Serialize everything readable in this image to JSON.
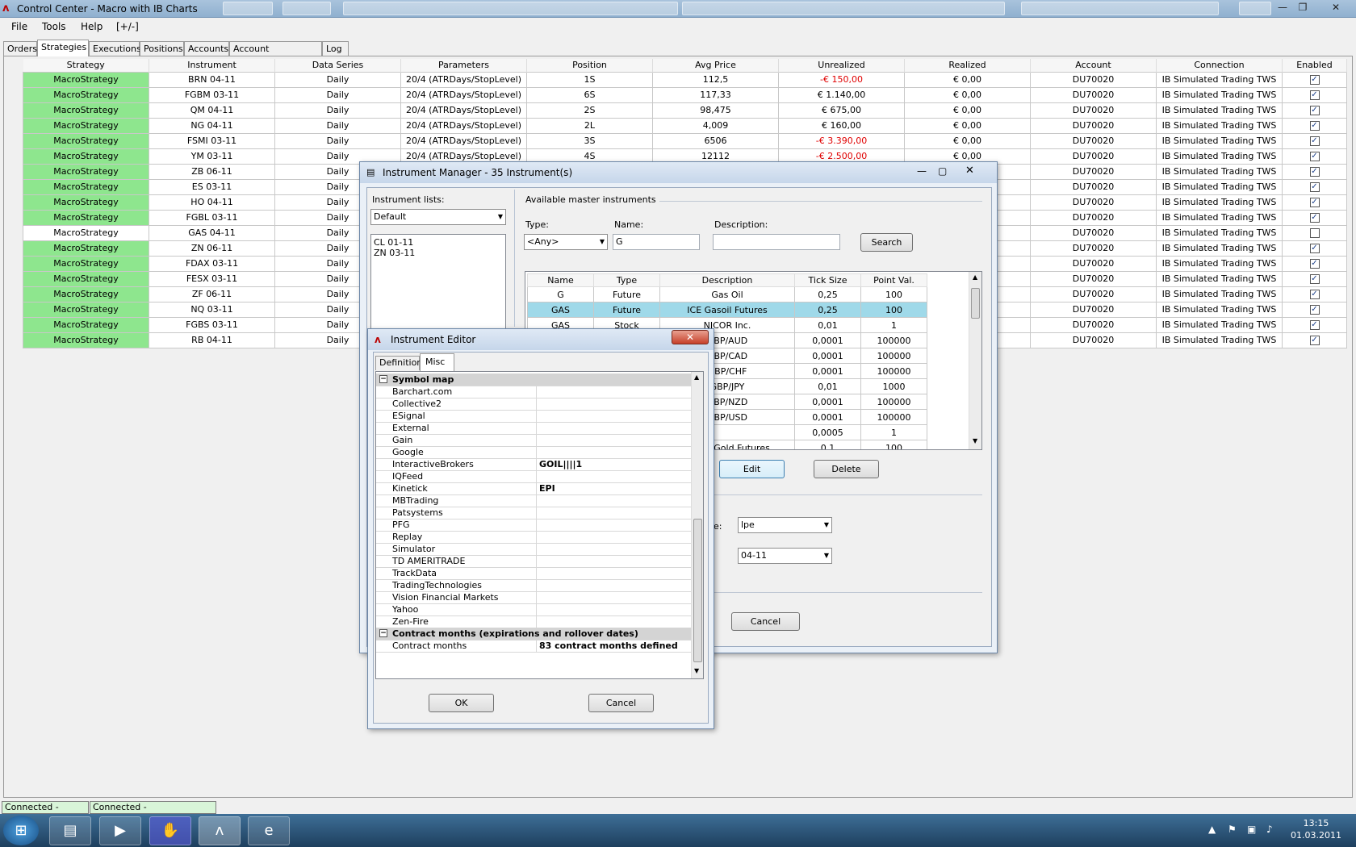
{
  "window": {
    "title": "Control Center - Macro with IB Charts"
  },
  "menu": [
    "File",
    "Tools",
    "Help",
    "[+/-]"
  ],
  "tabs": [
    "Orders",
    "Strategies",
    "Executions",
    "Positions",
    "Accounts",
    "Account Performance",
    "Log"
  ],
  "active_tab": "Strategies",
  "strategies": {
    "columns": [
      "Strategy",
      "Instrument",
      "Data Series",
      "Parameters",
      "Position",
      "Avg Price",
      "Unrealized",
      "Realized",
      "Account",
      "Connection",
      "Enabled"
    ],
    "rows": [
      {
        "strategy": "MacroStrategy",
        "instrument": "BRN 04-11",
        "series": "Daily",
        "params": "20/4 (ATRDays/StopLevel)",
        "position": "1S",
        "avg": "112,5",
        "unrealized": "-€ 150,00",
        "realized": "€ 0,00",
        "account": "DU70020",
        "connection": "IB Simulated Trading TWS",
        "enabled": true,
        "neg": true
      },
      {
        "strategy": "MacroStrategy",
        "instrument": "FGBM 03-11",
        "series": "Daily",
        "params": "20/4 (ATRDays/StopLevel)",
        "position": "6S",
        "avg": "117,33",
        "unrealized": "€ 1.140,00",
        "realized": "€ 0,00",
        "account": "DU70020",
        "connection": "IB Simulated Trading TWS",
        "enabled": true,
        "neg": false
      },
      {
        "strategy": "MacroStrategy",
        "instrument": "QM 04-11",
        "series": "Daily",
        "params": "20/4 (ATRDays/StopLevel)",
        "position": "2S",
        "avg": "98,475",
        "unrealized": "€ 675,00",
        "realized": "€ 0,00",
        "account": "DU70020",
        "connection": "IB Simulated Trading TWS",
        "enabled": true,
        "neg": false
      },
      {
        "strategy": "MacroStrategy",
        "instrument": "NG 04-11",
        "series": "Daily",
        "params": "20/4 (ATRDays/StopLevel)",
        "position": "2L",
        "avg": "4,009",
        "unrealized": "€ 160,00",
        "realized": "€ 0,00",
        "account": "DU70020",
        "connection": "IB Simulated Trading TWS",
        "enabled": true,
        "neg": false
      },
      {
        "strategy": "MacroStrategy",
        "instrument": "FSMI 03-11",
        "series": "Daily",
        "params": "20/4 (ATRDays/StopLevel)",
        "position": "3S",
        "avg": "6506",
        "unrealized": "-€ 3.390,00",
        "realized": "€ 0,00",
        "account": "DU70020",
        "connection": "IB Simulated Trading TWS",
        "enabled": true,
        "neg": true
      },
      {
        "strategy": "MacroStrategy",
        "instrument": "YM 03-11",
        "series": "Daily",
        "params": "20/4 (ATRDays/StopLevel)",
        "position": "4S",
        "avg": "12112",
        "unrealized": "-€ 2.500,00",
        "realized": "€ 0,00",
        "account": "DU70020",
        "connection": "IB Simulated Trading TWS",
        "enabled": true,
        "neg": true
      },
      {
        "strategy": "MacroStrategy",
        "instrument": "ZB 06-11",
        "series": "Daily",
        "params": "",
        "position": "",
        "avg": "",
        "unrealized": "",
        "realized": "€ 0,00",
        "account": "DU70020",
        "connection": "IB Simulated Trading TWS",
        "enabled": true,
        "neg": false
      },
      {
        "strategy": "MacroStrategy",
        "instrument": "ES 03-11",
        "series": "Daily",
        "params": "",
        "position": "",
        "avg": "",
        "unrealized": "",
        "realized": "€ 0,00",
        "account": "DU70020",
        "connection": "IB Simulated Trading TWS",
        "enabled": true,
        "neg": false
      },
      {
        "strategy": "MacroStrategy",
        "instrument": "HO 04-11",
        "series": "Daily",
        "params": "",
        "position": "",
        "avg": "",
        "unrealized": "",
        "realized": "€ 0,00",
        "account": "DU70020",
        "connection": "IB Simulated Trading TWS",
        "enabled": true,
        "neg": false
      },
      {
        "strategy": "MacroStrategy",
        "instrument": "FGBL 03-11",
        "series": "Daily",
        "params": "",
        "position": "",
        "avg": "",
        "unrealized": "",
        "realized": "€ 0,00",
        "account": "DU70020",
        "connection": "IB Simulated Trading TWS",
        "enabled": true,
        "neg": false
      },
      {
        "strategy": "MacroStrategy",
        "instrument": "GAS 04-11",
        "series": "Daily",
        "params": "",
        "position": "",
        "avg": "",
        "unrealized": "",
        "realized": "€ 0,00",
        "account": "DU70020",
        "connection": "IB Simulated Trading TWS",
        "enabled": false,
        "neg": false
      },
      {
        "strategy": "MacroStrategy",
        "instrument": "ZN 06-11",
        "series": "Daily",
        "params": "",
        "position": "",
        "avg": "",
        "unrealized": "",
        "realized": "€ 0,00",
        "account": "DU70020",
        "connection": "IB Simulated Trading TWS",
        "enabled": true,
        "neg": false
      },
      {
        "strategy": "MacroStrategy",
        "instrument": "FDAX 03-11",
        "series": "Daily",
        "params": "",
        "position": "",
        "avg": "",
        "unrealized": "",
        "realized": "€ 0,00",
        "account": "DU70020",
        "connection": "IB Simulated Trading TWS",
        "enabled": true,
        "neg": false
      },
      {
        "strategy": "MacroStrategy",
        "instrument": "FESX 03-11",
        "series": "Daily",
        "params": "",
        "position": "",
        "avg": "",
        "unrealized": "",
        "realized": "€ 0,00",
        "account": "DU70020",
        "connection": "IB Simulated Trading TWS",
        "enabled": true,
        "neg": false
      },
      {
        "strategy": "MacroStrategy",
        "instrument": "ZF 06-11",
        "series": "Daily",
        "params": "",
        "position": "",
        "avg": "",
        "unrealized": "",
        "realized": "€ 0,00",
        "account": "DU70020",
        "connection": "IB Simulated Trading TWS",
        "enabled": true,
        "neg": false
      },
      {
        "strategy": "MacroStrategy",
        "instrument": "NQ 03-11",
        "series": "Daily",
        "params": "",
        "position": "",
        "avg": "",
        "unrealized": "",
        "realized": "€ 0,00",
        "account": "DU70020",
        "connection": "IB Simulated Trading TWS",
        "enabled": true,
        "neg": false
      },
      {
        "strategy": "MacroStrategy",
        "instrument": "FGBS 03-11",
        "series": "Daily",
        "params": "",
        "position": "",
        "avg": "",
        "unrealized": "",
        "realized": "€ 0,00",
        "account": "DU70020",
        "connection": "IB Simulated Trading TWS",
        "enabled": true,
        "neg": false
      },
      {
        "strategy": "MacroStrategy",
        "instrument": "RB 04-11",
        "series": "Daily",
        "params": "",
        "position": "",
        "avg": "",
        "unrealized": "",
        "realized": "€ 0,00",
        "account": "DU70020",
        "connection": "IB Simulated Trading TWS",
        "enabled": true,
        "neg": false
      }
    ]
  },
  "instrument_manager": {
    "title": "Instrument Manager - 35 Instrument(s)",
    "lists_label": "Instrument lists:",
    "list_selected": "Default",
    "list_items": [
      "CL 01-11",
      "ZN 03-11"
    ],
    "available_label": "Available master instruments",
    "type_label": "Type:",
    "type_value": "<Any>",
    "name_label": "Name:",
    "name_value": "G",
    "desc_label": "Description:",
    "desc_value": "",
    "search_label": "Search",
    "columns": [
      "Name",
      "Type",
      "Description",
      "Tick Size",
      "Point Val."
    ],
    "rows": [
      {
        "name": "G",
        "type": "Future",
        "desc": "Gas Oil",
        "tick": "0,25",
        "point": "100",
        "sel": false
      },
      {
        "name": "GAS",
        "type": "Future",
        "desc": "ICE Gasoil Futures",
        "tick": "0,25",
        "point": "100",
        "sel": true
      },
      {
        "name": "GAS",
        "type": "Stock",
        "desc": "NICOR Inc.",
        "tick": "0,01",
        "point": "1",
        "sel": false
      },
      {
        "name": "",
        "type": "",
        "desc": "GBP/AUD",
        "tick": "0,0001",
        "point": "100000",
        "sel": false
      },
      {
        "name": "",
        "type": "",
        "desc": "GBP/CAD",
        "tick": "0,0001",
        "point": "100000",
        "sel": false
      },
      {
        "name": "",
        "type": "",
        "desc": "GBP/CHF",
        "tick": "0,0001",
        "point": "100000",
        "sel": false
      },
      {
        "name": "",
        "type": "",
        "desc": "GBP/JPY",
        "tick": "0,01",
        "point": "1000",
        "sel": false
      },
      {
        "name": "",
        "type": "",
        "desc": "GBP/NZD",
        "tick": "0,0001",
        "point": "100000",
        "sel": false
      },
      {
        "name": "",
        "type": "",
        "desc": "GBP/USD",
        "tick": "0,0001",
        "point": "100000",
        "sel": false
      },
      {
        "name": "",
        "type": "",
        "desc": "",
        "tick": "0,0005",
        "point": "1",
        "sel": false
      },
      {
        "name": "",
        "type": "",
        "desc": "OMEX Gold Futures",
        "tick": "0,1",
        "point": "100",
        "sel": false
      }
    ],
    "edit_label": "Edit",
    "delete_label": "Delete",
    "field1_value": "lpe",
    "field1_partial": "e:",
    "field2_value": "04-11",
    "cancel_label": "Cancel"
  },
  "instrument_editor": {
    "title": "Instrument Editor",
    "tabs": [
      "Definition",
      "Misc"
    ],
    "active_tab": "Misc",
    "cat1": "Symbol map",
    "symbols": [
      {
        "k": "Barchart.com",
        "v": ""
      },
      {
        "k": "Collective2",
        "v": ""
      },
      {
        "k": "ESignal",
        "v": ""
      },
      {
        "k": "External",
        "v": ""
      },
      {
        "k": "Gain",
        "v": ""
      },
      {
        "k": "Google",
        "v": ""
      },
      {
        "k": "InteractiveBrokers",
        "v": "GOIL||||1"
      },
      {
        "k": "IQFeed",
        "v": ""
      },
      {
        "k": "Kinetick",
        "v": "EPI"
      },
      {
        "k": "MBTrading",
        "v": ""
      },
      {
        "k": "Patsystems",
        "v": ""
      },
      {
        "k": "PFG",
        "v": ""
      },
      {
        "k": "Replay",
        "v": ""
      },
      {
        "k": "Simulator",
        "v": ""
      },
      {
        "k": "TD AMERITRADE",
        "v": ""
      },
      {
        "k": "TrackData",
        "v": ""
      },
      {
        "k": "TradingTechnologies",
        "v": ""
      },
      {
        "k": "Vision Financial Markets",
        "v": ""
      },
      {
        "k": "Yahoo",
        "v": ""
      },
      {
        "k": "Zen-Fire",
        "v": ""
      }
    ],
    "cat2": "Contract months (expirations and rollover dates)",
    "contract_key": "Contract months",
    "contract_val": "83 contract months defined",
    "ok_label": "OK",
    "cancel_label": "Cancel"
  },
  "status": [
    "Connected - Kinetick",
    "Connected - InteractiveBrokers"
  ],
  "clock": {
    "time": "13:15",
    "date": "01.03.2011"
  }
}
